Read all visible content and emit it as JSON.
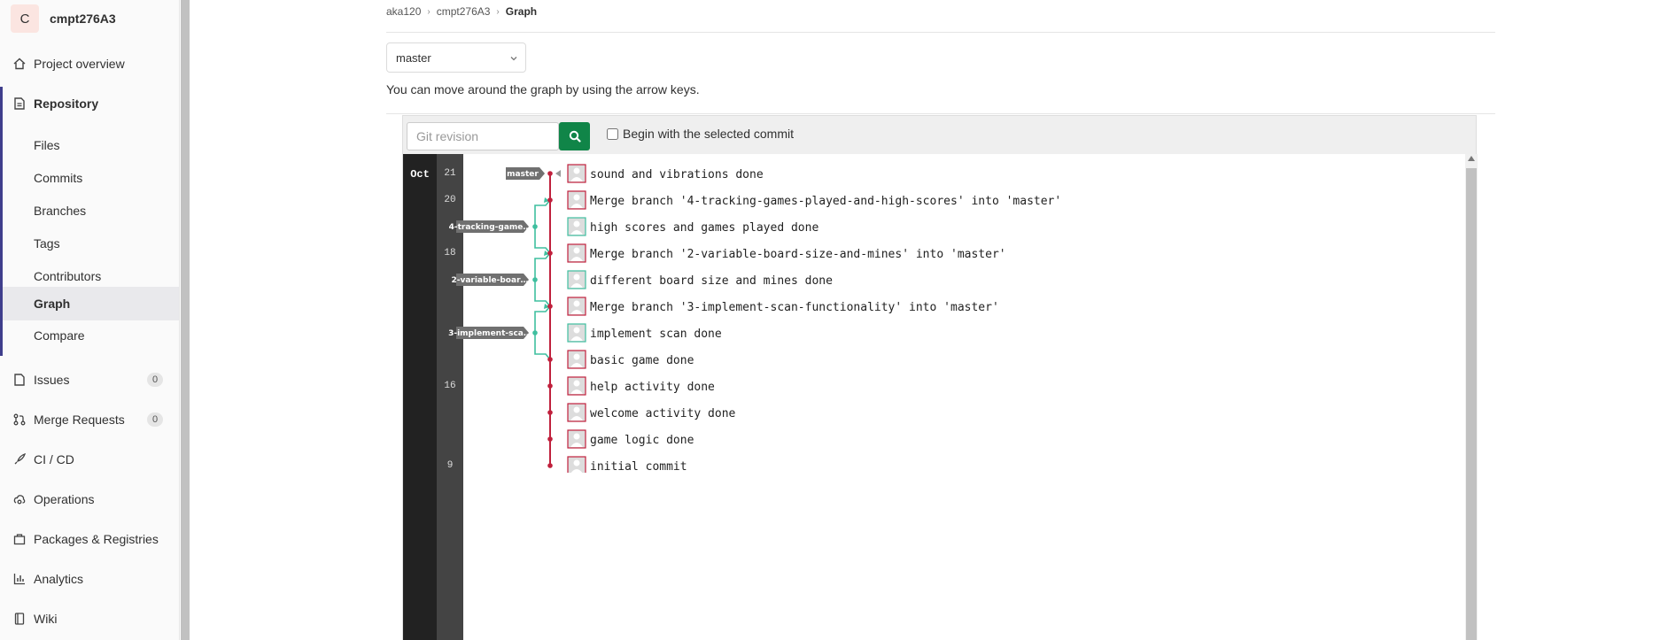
{
  "project": {
    "initial": "C",
    "name": "cmpt276A3"
  },
  "sidebar": {
    "project_overview": "Project overview",
    "repository": "Repository",
    "repo_items": [
      "Files",
      "Commits",
      "Branches",
      "Tags",
      "Contributors",
      "Graph",
      "Compare"
    ],
    "issues": {
      "label": "Issues",
      "count": "0"
    },
    "merge_requests": {
      "label": "Merge Requests",
      "count": "0"
    },
    "cicd": "CI / CD",
    "operations": "Operations",
    "packages": "Packages & Registries",
    "analytics": "Analytics",
    "wiki": "Wiki"
  },
  "breadcrumb": [
    "aka120",
    "cmpt276A3",
    "Graph"
  ],
  "branch_selector": {
    "value": "master"
  },
  "hint": "You can move around the graph by using the arrow keys.",
  "toolbar": {
    "revision_placeholder": "Git revision",
    "begin_label": "Begin with the selected commit"
  },
  "graph": {
    "month": "Oct",
    "days": [
      "21",
      "20",
      "18",
      "16",
      "9"
    ],
    "refs": [
      "master",
      "4-tracking-game…",
      "2-variable-boar…",
      "3-implement-sca…"
    ],
    "commits": [
      "sound and vibrations done",
      "Merge branch '4-tracking-games-played-and-high-scores' into 'master'",
      "high scores and games played done",
      "Merge branch '2-variable-board-size-and-mines' into 'master'",
      "different board size and mines done",
      "Merge branch '3-implement-scan-functionality' into 'master'",
      "implement scan done",
      "basic game done",
      "help activity done",
      "welcome activity done",
      "game logic done",
      "initial commit"
    ],
    "colors": {
      "master": "#c0203c",
      "branch": "#3fbf9f",
      "ref_bg": "#707070"
    }
  }
}
